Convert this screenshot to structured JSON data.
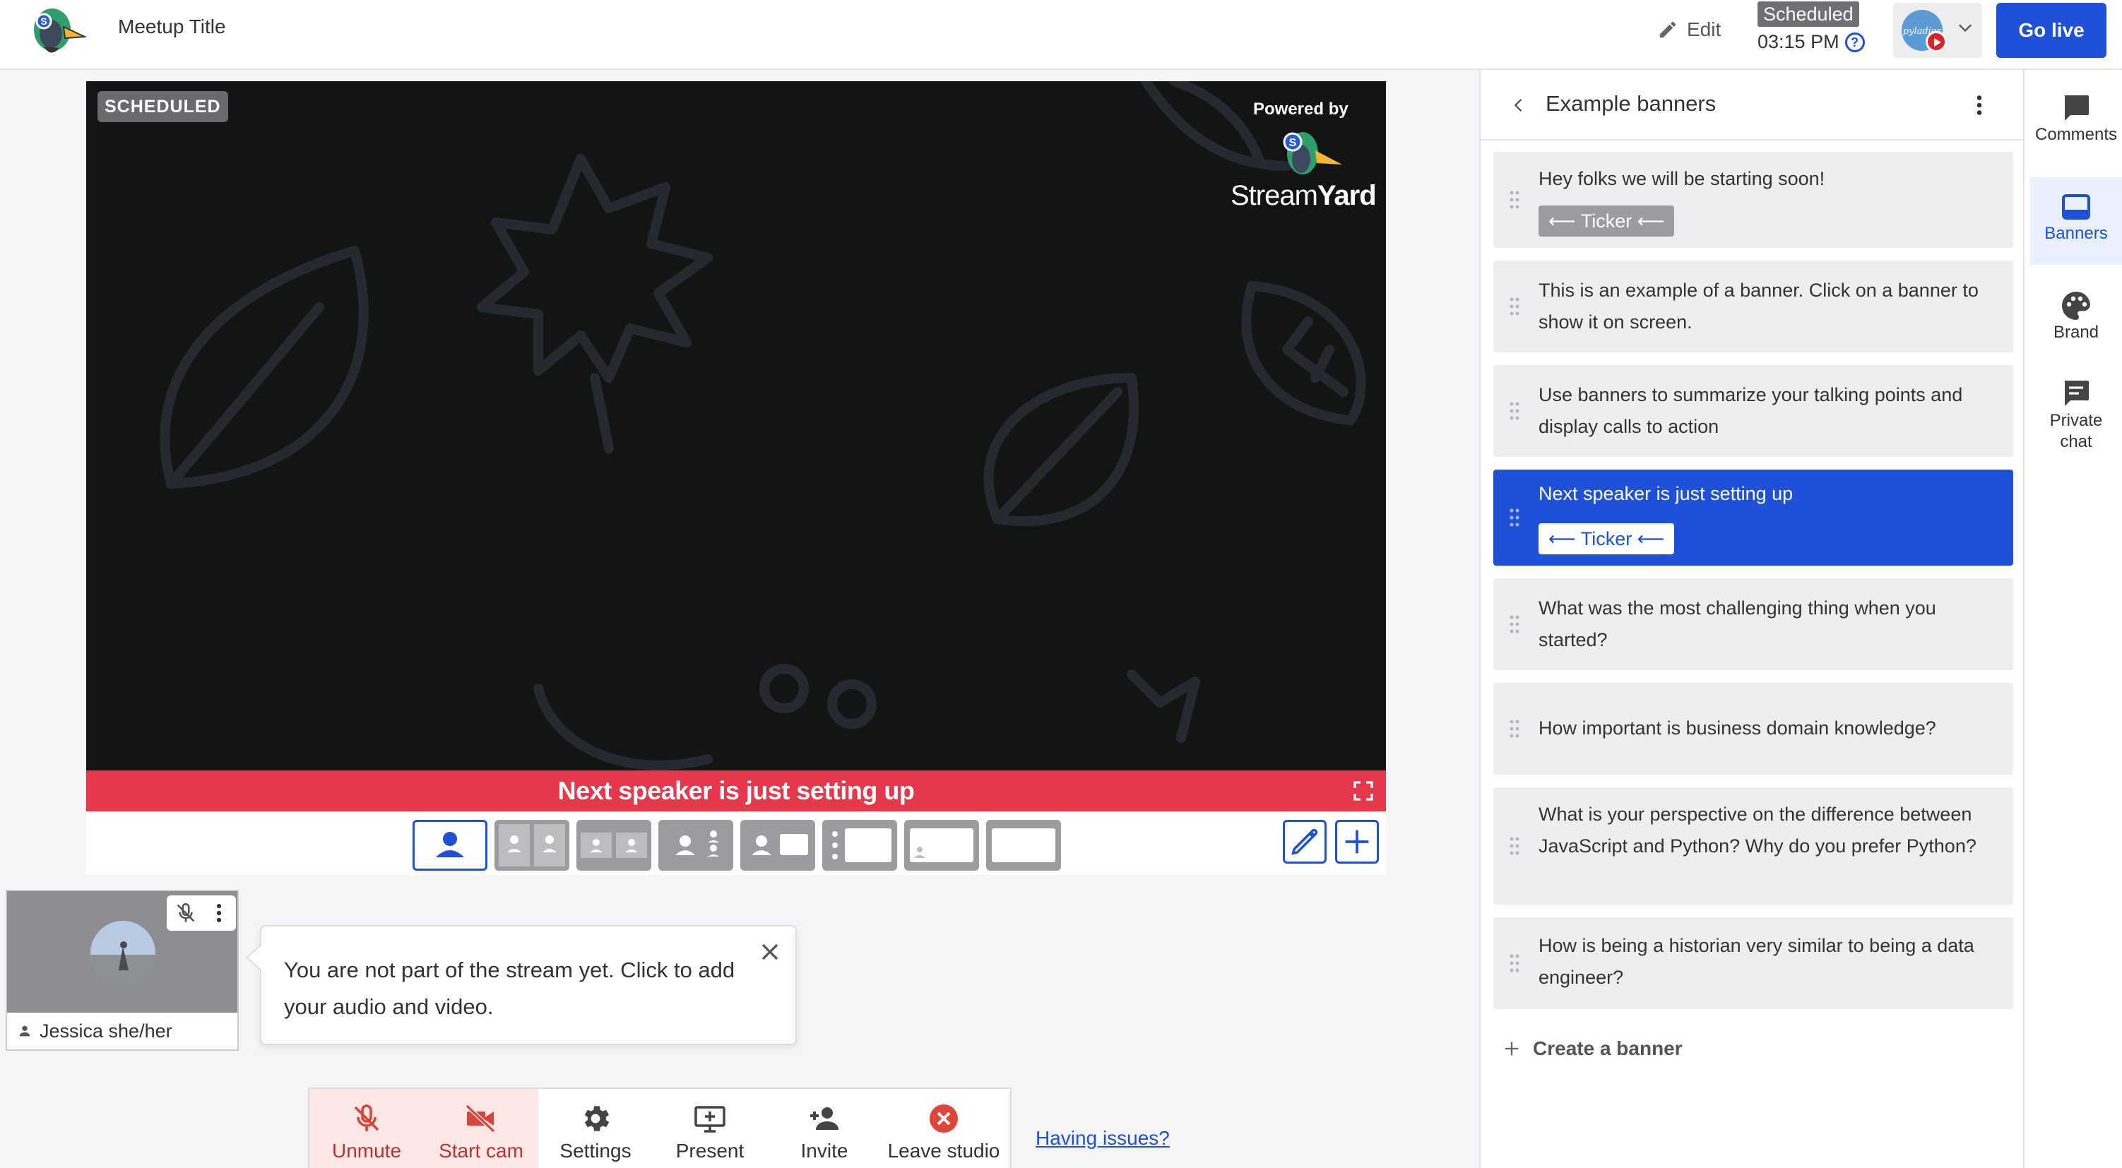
{
  "header": {
    "title": "Meetup Title",
    "edit_label": "Edit",
    "status_badge": "Scheduled",
    "scheduled_time": "03:15 PM",
    "go_live_label": "Go live",
    "destination_avatar_text": "pyladies"
  },
  "stage": {
    "status_badge": "SCHEDULED",
    "powered_by": "Powered by",
    "brand_word_light": "Stream",
    "brand_word_bold": "Yard",
    "banner_text": "Next speaker is just setting up"
  },
  "participant": {
    "name": "Jessica she/her"
  },
  "tooltip": {
    "text": "You are not part of the stream yet. Click to add your audio and video."
  },
  "controls": {
    "unmute": "Unmute",
    "start_cam": "Start cam",
    "settings": "Settings",
    "present": "Present",
    "invite": "Invite",
    "leave": "Leave studio",
    "having_issues": "Having issues?"
  },
  "banners_panel": {
    "title": "Example banners",
    "ticker_label": "Ticker",
    "create_label": "Create a banner",
    "items": [
      {
        "text": "Hey folks we will be starting soon!",
        "ticker": true,
        "active": false
      },
      {
        "text": "This is an example of a banner. Click on a banner to show it on screen.",
        "ticker": false,
        "active": false
      },
      {
        "text": "Use banners to summarize your talking points and display calls to action",
        "ticker": false,
        "active": false
      },
      {
        "text": "Next speaker is just setting up",
        "ticker": true,
        "active": true
      },
      {
        "text": "What was the most challenging thing when you started?",
        "ticker": false,
        "active": false
      },
      {
        "text": "How important is business domain knowledge?",
        "ticker": false,
        "active": false
      },
      {
        "text": "What is your perspective on the difference between JavaScript and Python? Why do you prefer Python?",
        "ticker": false,
        "active": false
      },
      {
        "text": "How is being a historian very similar to being a data engineer?",
        "ticker": false,
        "active": false
      }
    ]
  },
  "rail": {
    "comments": "Comments",
    "banners": "Banners",
    "brand": "Brand",
    "private_chat_line1": "Private",
    "private_chat_line2": "chat"
  },
  "colors": {
    "accent": "#1e50d8",
    "banner_red": "#e5384a",
    "stage_bg": "#141414",
    "badge_gray": "#707074"
  },
  "icons": {
    "edit": "pencil-icon",
    "help": "question-circle-icon",
    "chevron": "chevron-down-icon",
    "fullscreen": "fullscreen-icon",
    "mic_off": "mic-off-icon",
    "cam_off": "cam-off-icon",
    "settings": "gear-icon",
    "present": "screen-share-icon",
    "invite": "person-add-icon",
    "leave": "close-circle-icon"
  }
}
